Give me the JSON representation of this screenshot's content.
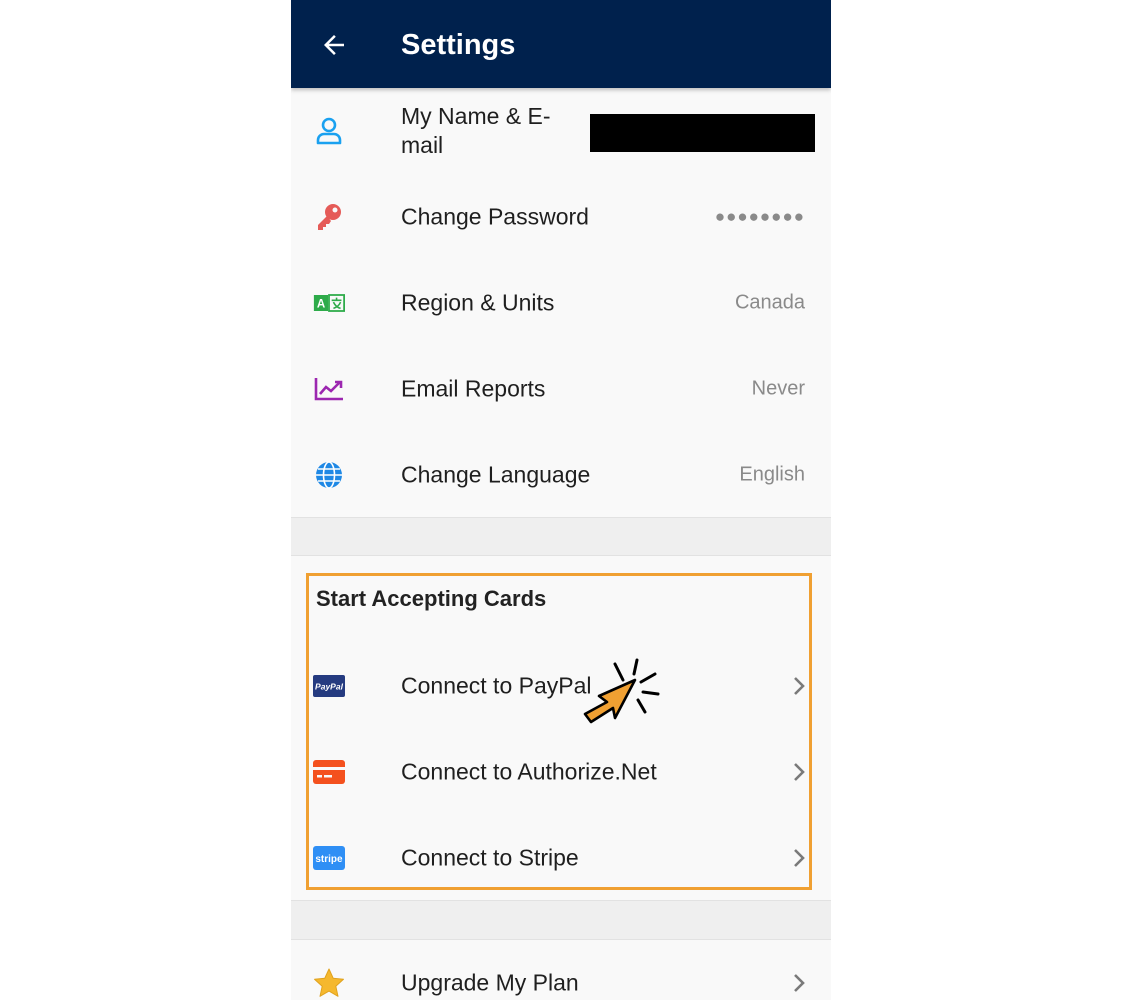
{
  "appbar": {
    "title": "Settings",
    "back_icon": "arrow-left-icon"
  },
  "account_rows": [
    {
      "label": "My Name & E-mail",
      "value": "",
      "icon": "user-icon",
      "icon_color": "#1aa1f0"
    },
    {
      "label": "Change Password",
      "value": "●●●●●●●●",
      "icon": "key-icon",
      "icon_color": "#e55b58"
    },
    {
      "label": "Region & Units",
      "value": "Canada",
      "icon": "translate-icon",
      "icon_color": "#2eab4a"
    },
    {
      "label": "Email Reports",
      "value": "Never",
      "icon": "chart-line-icon",
      "icon_color": "#9c27b0"
    },
    {
      "label": "Change Language",
      "value": "English",
      "icon": "globe-icon",
      "icon_color": "#1e88e5"
    }
  ],
  "cards_section": {
    "title": "Start Accepting Cards",
    "rows": [
      {
        "label": "Connect to PayPal",
        "icon": "paypal-icon",
        "icon_text": "PayPal",
        "icon_color": "#253b80"
      },
      {
        "label": "Connect to Authorize.Net",
        "icon": "credit-card-icon",
        "icon_color": "#f4511e"
      },
      {
        "label": "Connect to Stripe",
        "icon": "stripe-icon",
        "icon_text": "stripe",
        "icon_color": "#2f8ff5"
      }
    ]
  },
  "plan_row": {
    "label": "Upgrade My Plan",
    "icon": "star-icon",
    "icon_color": "#f5b82e"
  },
  "colors": {
    "appbar": "#00214d",
    "highlight": "#f0a032",
    "cursor": "#f0a032"
  }
}
